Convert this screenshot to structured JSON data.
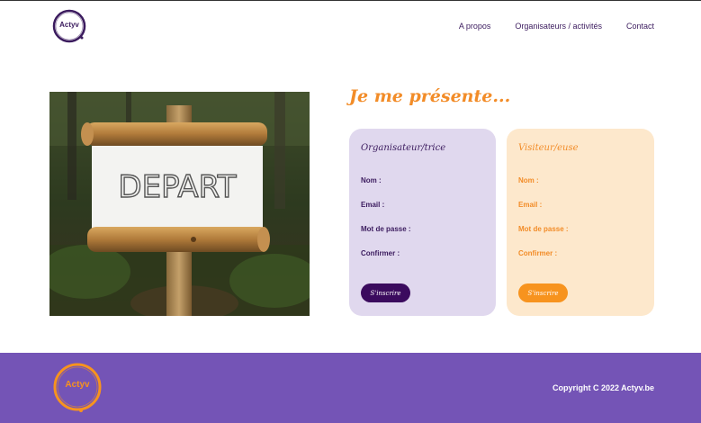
{
  "brand": {
    "name": "Actyv"
  },
  "nav": {
    "items": [
      {
        "label": "A propos"
      },
      {
        "label": "Organisateurs / activités"
      },
      {
        "label": "Contact"
      }
    ]
  },
  "hero_image": {
    "sign_text": "DEPART"
  },
  "main": {
    "heading": "Je me présente..."
  },
  "cards": {
    "organizer": {
      "title": "Organisateur/trice",
      "fields": [
        "Nom :",
        "Email :",
        "Mot de passe :",
        "Confirmer :"
      ],
      "button": "S'inscrire",
      "accent": "#3b0b5e",
      "background": "#e0d8ee"
    },
    "visitor": {
      "title": "Visiteur/euse",
      "fields": [
        "Nom :",
        "Email :",
        "Mot de passe :",
        "Confirmer :"
      ],
      "button": "S'inscrire",
      "accent": "#f7931e",
      "background": "#fde8cc"
    }
  },
  "footer": {
    "copyright": "Copyright C 2022 Actyv.be",
    "background": "#7454b6"
  }
}
